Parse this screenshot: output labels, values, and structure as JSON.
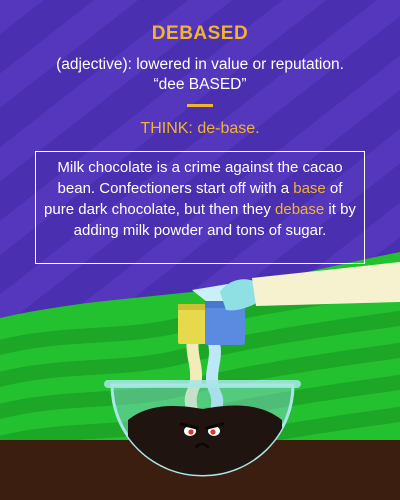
{
  "headword": "DEBASED",
  "definition_line1": "(adjective): lowered in value or reputation.",
  "definition_line2": "“dee BASED”",
  "think_text": "THINK: de-base.",
  "story": {
    "part1": "Milk chocolate is a crime against the cacao bean. Confectioners start off with a ",
    "highlight1": "base",
    "part2": " of pure dark chocolate, but then they ",
    "highlight2": "debase",
    "part3": " it by adding milk powder and tons of sugar."
  },
  "colors": {
    "purple_sky": "#4a2fb0",
    "accent_yellow": "#f2b42d",
    "green_field": "#23c12f",
    "soil": "#3b1e10",
    "chocolate": "#1f1410",
    "bowl": "#8fd8dc",
    "milk_carton": "#5a8be0",
    "sugar_packet": "#e7d94c",
    "sleeve": "#f6f1cf"
  },
  "icons": [
    "hand-sleeve-icon",
    "milk-carton-icon",
    "sugar-packet-icon",
    "glass-bowl-icon",
    "angry-chocolate-face-icon"
  ]
}
